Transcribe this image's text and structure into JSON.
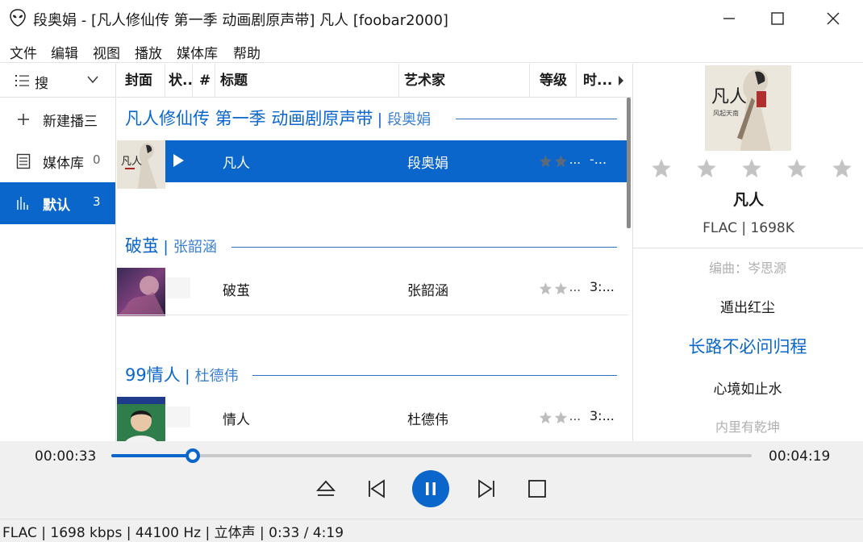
{
  "window": {
    "title": "段奥娟 - [凡人修仙传 第一季 动画剧原声带] 凡人  [foobar2000]",
    "app_icon": "alien-icon",
    "controls": [
      "minimize-icon",
      "maximize-icon",
      "close-icon"
    ]
  },
  "menu": [
    "文件",
    "编辑",
    "视图",
    "播放",
    "媒体库",
    "帮助"
  ],
  "sidebar": {
    "search_label": "搜",
    "items": [
      {
        "icon": "plus-icon",
        "label": "新建播三",
        "count": ""
      },
      {
        "icon": "library-icon",
        "label": "媒体库",
        "count": "0"
      },
      {
        "icon": "bars-icon",
        "label": "默认",
        "count": "3"
      }
    ]
  },
  "columns": [
    "封面",
    "状..",
    "#",
    "标题",
    "艺术家",
    "等级",
    "时..."
  ],
  "groups": [
    {
      "album": "凡人修仙传 第一季 动画剧原声带",
      "artist": "段奥娟",
      "track": {
        "title": "凡人",
        "artist": "段奥娟",
        "rating": 0,
        "time": "-...",
        "playing": true
      }
    },
    {
      "album": "破茧",
      "artist": "张韶涵",
      "track": {
        "title": "破茧",
        "artist": "张韶涵",
        "rating": 0,
        "time": "3:...",
        "playing": false
      }
    },
    {
      "album": "99情人",
      "artist": "杜德伟",
      "track": {
        "title": "情人",
        "artist": "杜德伟",
        "rating": 0,
        "time": "3:...",
        "playing": false
      }
    }
  ],
  "now_playing": {
    "title": "凡人",
    "format": "FLAC  | 1698K",
    "rating": 0,
    "lyrics": [
      {
        "text": "编曲：岑思源",
        "state": "dim"
      },
      {
        "text": "遁出红尘",
        "state": "normal"
      },
      {
        "text": "长路不必问归程",
        "state": "current"
      },
      {
        "text": "心境如止水",
        "state": "normal"
      },
      {
        "text": "内里有乾坤",
        "state": "dim"
      }
    ]
  },
  "transport": {
    "elapsed": "00:00:33",
    "total": "00:04:19",
    "progress": 0.127,
    "buttons": [
      "eject-icon",
      "previous-icon",
      "pause-icon",
      "next-icon",
      "stop-icon"
    ]
  },
  "status": "FLAC | 1698 kbps | 44100 Hz | 立体声 | 0:33 / 4:19",
  "colors": {
    "accent": "#0b66cc",
    "star_inactive": "#bdbdbd",
    "star_dark": "#5a6a7a"
  }
}
